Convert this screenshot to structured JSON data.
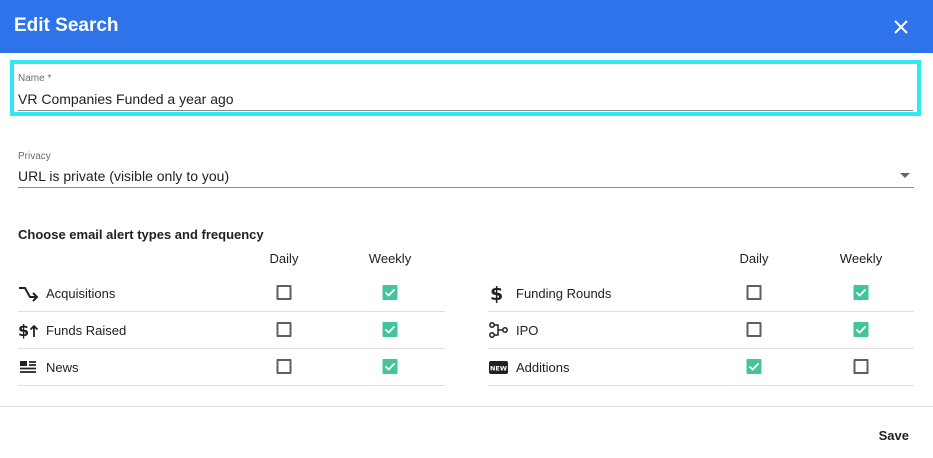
{
  "dialog": {
    "title": "Edit Search"
  },
  "name_field": {
    "label": "Name *",
    "value": "VR Companies Funded a year ago"
  },
  "privacy_field": {
    "label": "Privacy",
    "value": "URL is private (visible only to you)"
  },
  "alerts": {
    "title": "Choose email alert types and frequency",
    "col_daily": "Daily",
    "col_weekly": "Weekly",
    "left": [
      {
        "label": "Acquisitions",
        "icon": "acquisition-arrow-icon",
        "daily": false,
        "weekly": true
      },
      {
        "label": "Funds Raised",
        "icon": "funds-raised-icon",
        "daily": false,
        "weekly": true
      },
      {
        "label": "News",
        "icon": "news-icon",
        "daily": false,
        "weekly": true
      }
    ],
    "right": [
      {
        "label": "Funding Rounds",
        "icon": "dollar-icon",
        "daily": false,
        "weekly": true
      },
      {
        "label": "IPO",
        "icon": "ipo-icon",
        "daily": false,
        "weekly": true
      },
      {
        "label": "Additions",
        "icon": "new-badge-icon",
        "daily": true,
        "weekly": false
      }
    ]
  },
  "actions": {
    "save_label": "Save"
  },
  "colors": {
    "header": "#2e73ea",
    "focus_outline": "#31e9f2",
    "checked": "#43c49a"
  }
}
